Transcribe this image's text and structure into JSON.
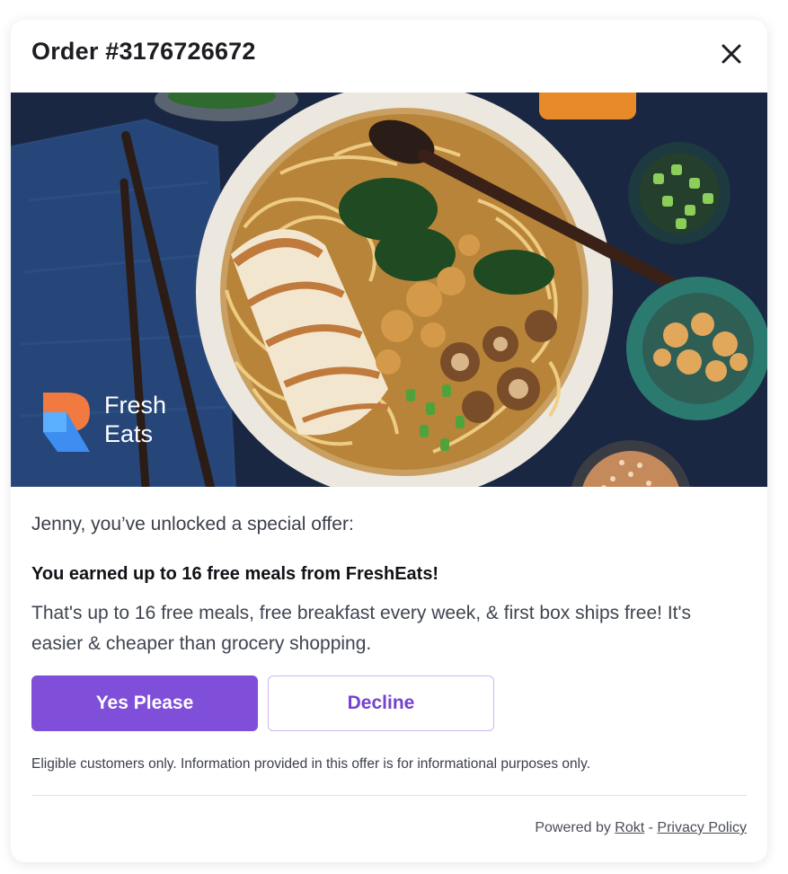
{
  "modal": {
    "order_title": "Order #3176726672",
    "close_icon": "close-icon"
  },
  "hero": {
    "image_subject": "ramen-bowl-photo",
    "logo": {
      "line1": "Fresh",
      "line2": "Eats",
      "colors": [
        "#f07a3f",
        "#3d8ef0"
      ]
    }
  },
  "offer": {
    "greeting": "Jenny, you’ve unlocked a special offer:",
    "headline": "You earned up to 16 free meals from FreshEats!",
    "description": "That's up to 16 free meals, free breakfast every week, & first box ships free! It's easier & cheaper than grocery shopping.",
    "accept_label": "Yes Please",
    "decline_label": "Decline",
    "disclaimer": "Eligible customers only. Information provided in this offer is for informational purposes only."
  },
  "footer": {
    "powered_by": "Powered by ",
    "provider_link": "Rokt",
    "separator": " - ",
    "privacy_link": "Privacy Policy"
  },
  "colors": {
    "accent": "#7f4fd9",
    "decline_border": "#cdb6f2",
    "decline_text": "#7343d0"
  }
}
